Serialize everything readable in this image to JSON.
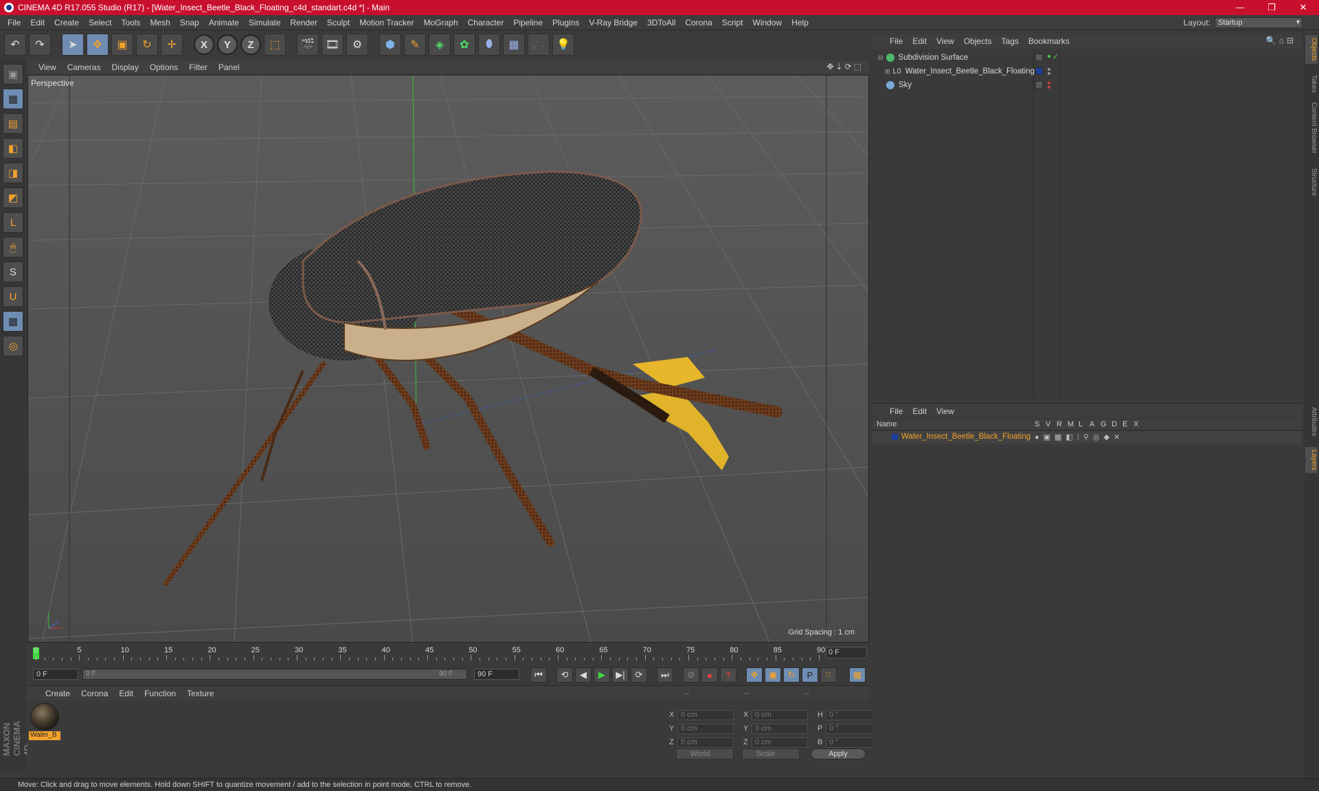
{
  "window": {
    "title": "CINEMA 4D R17.055 Studio (R17) - [Water_Insect_Beetle_Black_Floating_c4d_standart.c4d *] - Main",
    "controls": [
      "—",
      "❐",
      "✕"
    ]
  },
  "menubar": {
    "items": [
      "File",
      "Edit",
      "Create",
      "Select",
      "Tools",
      "Mesh",
      "Snap",
      "Animate",
      "Simulate",
      "Render",
      "Sculpt",
      "Motion Tracker",
      "MoGraph",
      "Character",
      "Pipeline",
      "Plugins",
      "V-Ray Bridge",
      "3DToAll",
      "Corona",
      "Script",
      "Window",
      "Help"
    ],
    "layout_label": "Layout:",
    "layout_value": "Startup"
  },
  "toolbar": {
    "undo": "↶",
    "redo": "↷",
    "select": "➤",
    "move": "✥",
    "scale": "▣",
    "rotate": "↻",
    "last": "✛",
    "x": "X",
    "y": "Y",
    "z": "Z",
    "coord": "⬚",
    "render_view": "🎬",
    "render": "🎞",
    "render_settings": "⚙",
    "cube": "⬢",
    "pen": "✎",
    "subdiv": "◈",
    "mograph": "✿",
    "deformer": "⬮",
    "floor": "▦",
    "camera": "🎥",
    "light": "💡"
  },
  "left_toolbar": [
    "▣",
    "▦",
    "▤",
    "◧",
    "◨",
    "◩",
    "L",
    "🖱",
    "S",
    "U",
    "▦",
    "◎"
  ],
  "maxon_logo": "MAXON CINEMA 4D",
  "viewport": {
    "menu": [
      "View",
      "Cameras",
      "Display",
      "Options",
      "Filter",
      "Panel"
    ],
    "nav_icons": "✥⇣⟳⬚",
    "label": "Perspective",
    "grid_spacing": "Grid Spacing : 1 cm"
  },
  "timeline": {
    "ticks": [
      0,
      5,
      10,
      15,
      20,
      25,
      30,
      35,
      40,
      45,
      50,
      55,
      60,
      65,
      70,
      75,
      80,
      85,
      90
    ],
    "current_frame": "0 F"
  },
  "transport": {
    "start_field": "0 F",
    "range_start": "0 F",
    "range_end": "90 F",
    "end_field": "90 F",
    "buttons": [
      "⏮",
      "⟲",
      "◀",
      "▶",
      "▶|",
      "⟳",
      "⏭"
    ],
    "key_buttons": [
      "⊘",
      "●",
      "?",
      "✥",
      "▣",
      "↻",
      "P",
      "⁙",
      "▦"
    ]
  },
  "material_manager": {
    "menu": [
      "Create",
      "Corona",
      "Edit",
      "Function",
      "Texture"
    ],
    "material_name": "Water_B"
  },
  "coordinates": {
    "head": [
      "--",
      "--",
      "--"
    ],
    "rows": [
      {
        "a": "X",
        "av": "0 cm",
        "b": "X",
        "bv": "0 cm",
        "c": "H",
        "cv": "0 °"
      },
      {
        "a": "Y",
        "av": "0 cm",
        "b": "Y",
        "bv": "0 cm",
        "c": "P",
        "cv": "0 °"
      },
      {
        "a": "Z",
        "av": "0 cm",
        "b": "Z",
        "bv": "0 cm",
        "c": "B",
        "cv": "0 °"
      }
    ],
    "mode": "World",
    "scale": "Scale",
    "apply": "Apply"
  },
  "object_manager": {
    "menu": [
      "File",
      "Edit",
      "View",
      "Objects",
      "Tags",
      "Bookmarks"
    ],
    "tools": "🔍⌂⊟",
    "objects": [
      {
        "name": "Subdivision Surface",
        "icon_color": "#4fb86a"
      },
      {
        "name": "Water_Insect_Beetle_Black_Floating",
        "icon_color": "#a0a0a0"
      },
      {
        "name": "Sky",
        "icon_color": "#7aa7d8"
      }
    ]
  },
  "layers_manager": {
    "menu": [
      "File",
      "Edit",
      "View"
    ],
    "header": {
      "name": "Name",
      "cols": [
        "S",
        "V",
        "R",
        "M",
        "L",
        "A",
        "G",
        "D",
        "E",
        "X"
      ]
    },
    "layer": "Water_Insect_Beetle_Black_Floating",
    "layer_color": "#1b3d9c"
  },
  "right_tabs": [
    "Objects",
    "Takes",
    "Content Browser",
    "Structure",
    "Attributes",
    "Layers"
  ],
  "status": "Move: Click and drag to move elements. Hold down SHIFT to quantize movement / add to the selection in point mode, CTRL to remove.",
  "colors": {
    "accent": "#f3a22c",
    "title_bar": "#c8102e",
    "selection": "#6f8db2"
  }
}
